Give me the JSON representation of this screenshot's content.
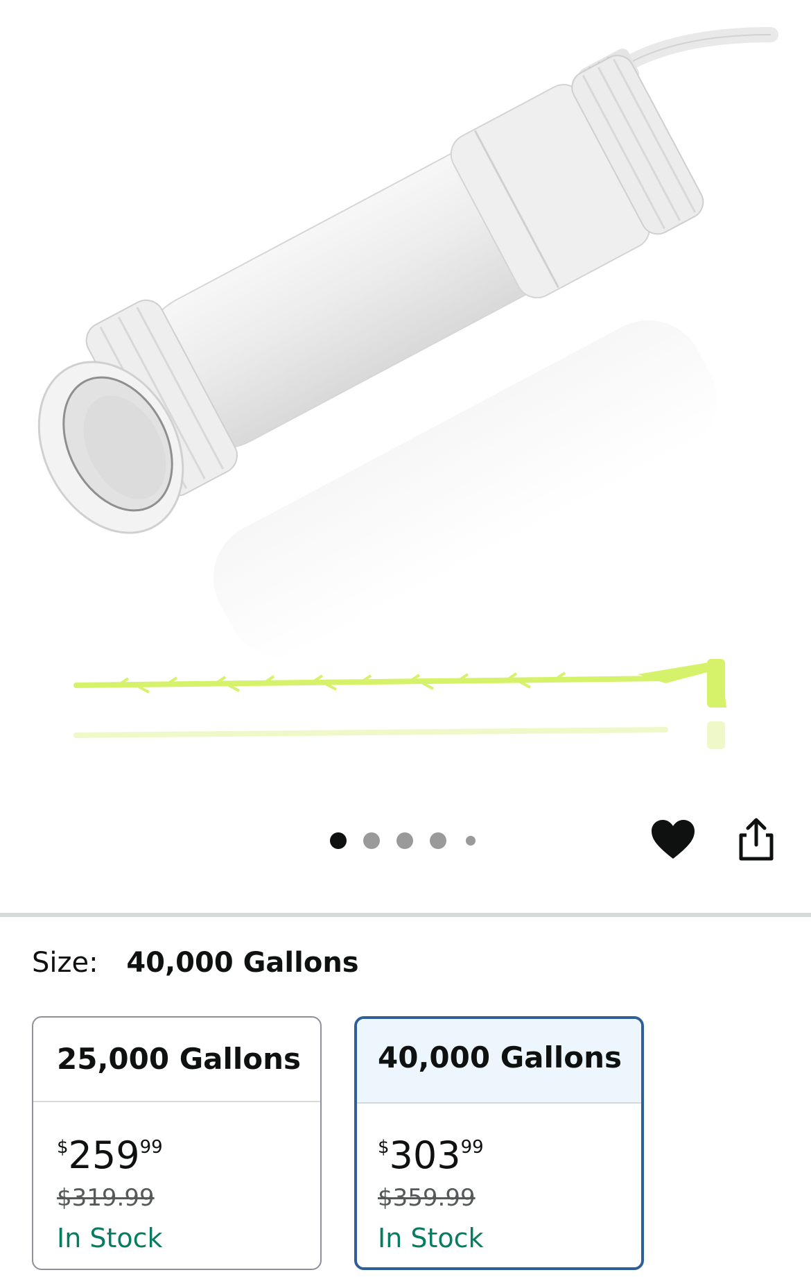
{
  "gallery": {
    "image_alt": "Saltwater pool chlorinator cell with drain cleaning stick",
    "dots_count": 5,
    "active_dot": 0,
    "favorite_icon": "heart-icon",
    "share_icon": "share-icon"
  },
  "size": {
    "label": "Size:",
    "selected": "40,000 Gallons"
  },
  "options": [
    {
      "title": "25,000 Gallons",
      "currency": "$",
      "price_whole": "259",
      "price_cents": "99",
      "list_price": "$319.99",
      "availability": "In Stock",
      "selected": false
    },
    {
      "title": "40,000 Gallons",
      "currency": "$",
      "price_whole": "303",
      "price_cents": "99",
      "list_price": "$359.99",
      "availability": "In Stock",
      "selected": true
    }
  ],
  "colors": {
    "selected_border": "#2f5f98",
    "selected_header_bg": "#edf6fc",
    "in_stock": "#067d62",
    "accent_green": "#d6f26a"
  }
}
